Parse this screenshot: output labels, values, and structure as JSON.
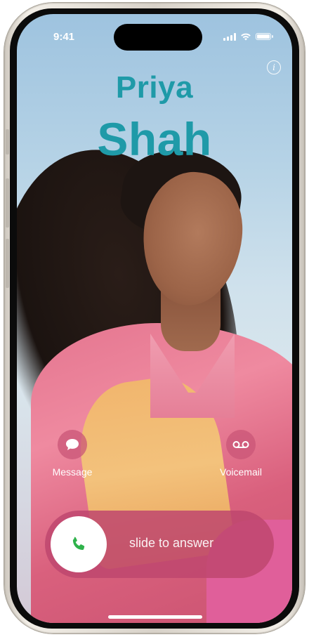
{
  "status_bar": {
    "time": "9:41"
  },
  "caller": {
    "first_name": "Priya",
    "last_name": "Shah"
  },
  "actions": {
    "message_label": "Message",
    "voicemail_label": "Voicemail"
  },
  "slider": {
    "label": "slide to answer"
  },
  "icons": {
    "info": "info-icon",
    "message": "message-bubble-icon",
    "voicemail": "voicemail-icon",
    "phone": "phone-icon",
    "signal": "cellular-signal-icon",
    "wifi": "wifi-icon",
    "battery": "battery-icon"
  },
  "colors": {
    "name_color": "#1f9aa8",
    "slider_bg": "#be466e",
    "phone_icon": "#2fb24b"
  }
}
